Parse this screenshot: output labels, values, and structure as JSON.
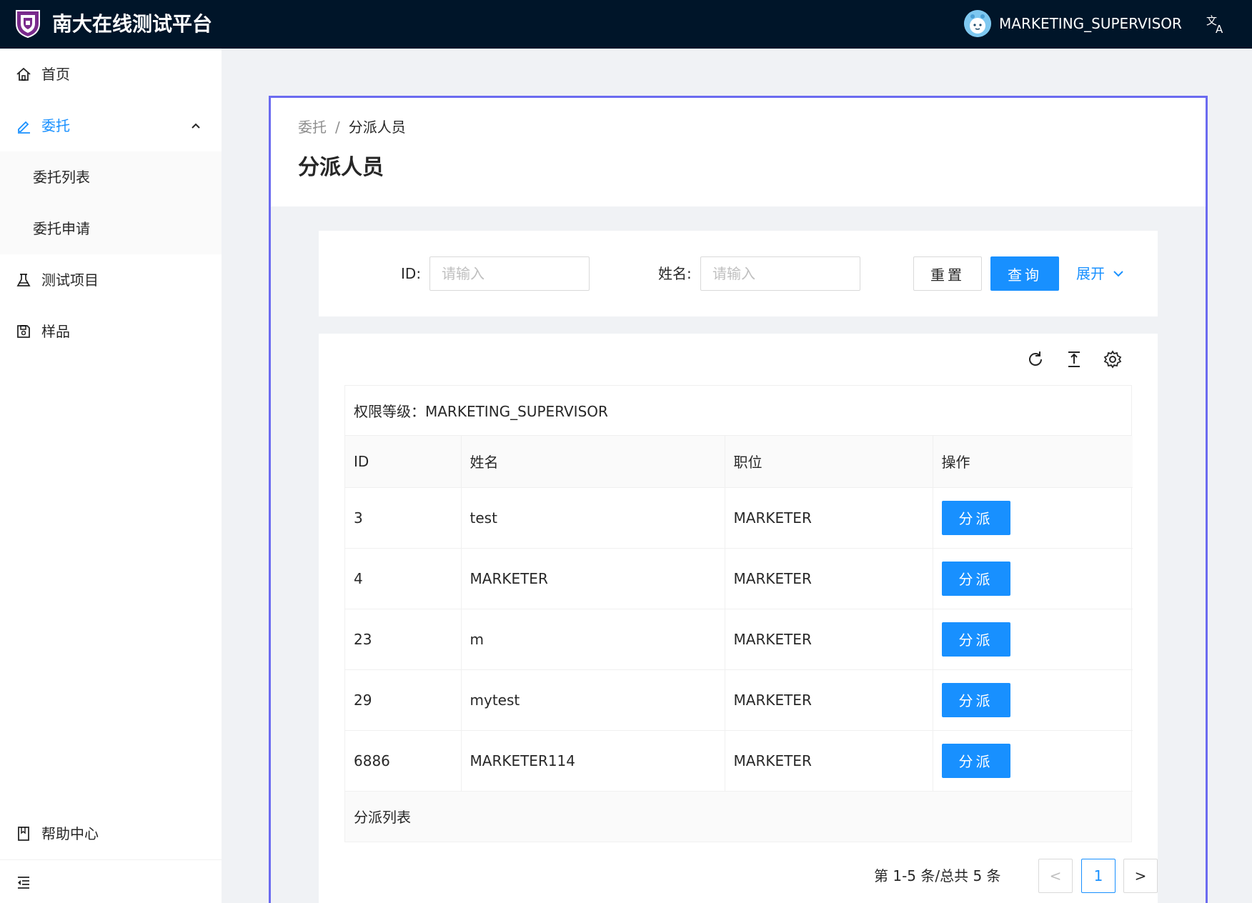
{
  "header": {
    "app_title": "南大在线测试平台",
    "username": "MARKETING_SUPERVISOR",
    "lang_icon": "translate-icon",
    "logo_icon": "university-shield-icon"
  },
  "sidebar": {
    "items": [
      {
        "label": "首页",
        "icon": "home-icon"
      },
      {
        "label": "委托",
        "icon": "edit-icon",
        "active": true,
        "expanded": true,
        "children": [
          {
            "label": "委托列表"
          },
          {
            "label": "委托申请"
          }
        ]
      },
      {
        "label": "测试项目",
        "icon": "flask-icon"
      },
      {
        "label": "样品",
        "icon": "save-icon"
      }
    ],
    "help_center": "帮助中心",
    "collapse_icon": "menu-fold-icon"
  },
  "breadcrumb": {
    "parent": "委托",
    "separator": "/",
    "current": "分派人员"
  },
  "page_title": "分派人员",
  "search": {
    "id_label": "ID",
    "id_placeholder": "请输入",
    "name_label": "姓名",
    "name_placeholder": "请输入",
    "reset_label": "重置",
    "query_label": "查询",
    "expand_label": "展开"
  },
  "table": {
    "title": "权限等级：MARKETING_SUPERVISOR",
    "columns": [
      "ID",
      "姓名",
      "职位",
      "操作"
    ],
    "rows": [
      {
        "id": "3",
        "name": "test",
        "position": "MARKETER",
        "action": "分派"
      },
      {
        "id": "4",
        "name": "MARKETER",
        "position": "MARKETER",
        "action": "分派"
      },
      {
        "id": "23",
        "name": "m",
        "position": "MARKETER",
        "action": "分派"
      },
      {
        "id": "29",
        "name": "mytest",
        "position": "MARKETER",
        "action": "分派"
      },
      {
        "id": "6886",
        "name": "MARKETER114",
        "position": "MARKETER",
        "action": "分派"
      }
    ],
    "footer": "分派列表"
  },
  "pagination": {
    "total_text": "第 1-5 条/总共 5 条",
    "current_page": "1",
    "prev": "<",
    "next": ">"
  },
  "colors": {
    "header_bg": "#001529",
    "primary": "#1890ff",
    "frame_border": "#6b6bf0"
  }
}
